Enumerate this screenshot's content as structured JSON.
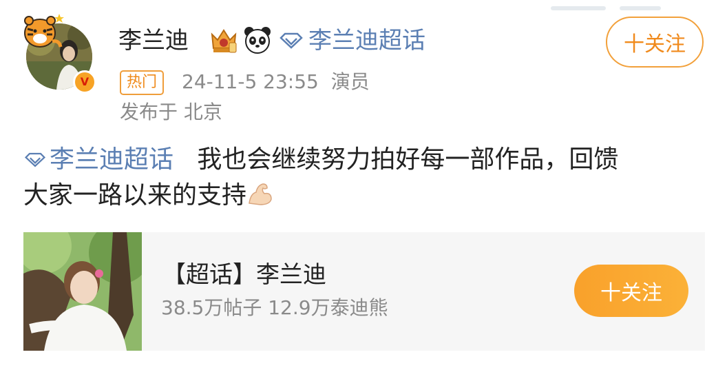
{
  "post": {
    "username": "李兰迪",
    "chaohua_link": "李兰迪超话",
    "follow_label": "十关注",
    "hot_tag": "热门",
    "timestamp": "24-11-5 23:55",
    "role": "演员",
    "location": "发布于 北京",
    "topic": "李兰迪超话",
    "text_line1": "我也会继续努力拍好每一部作品，回馈",
    "text_line2": "大家一路以来的支持"
  },
  "card": {
    "title": "【超话】李兰迪",
    "stats": "38.5万帖子 12.9万泰迪熊",
    "follow_label": "十关注"
  },
  "colors": {
    "link_blue": "#5b7fb3",
    "accent_orange": "#f7a325",
    "muted_gray": "#8a8a8a"
  },
  "icons": [
    "tiger-sticker-icon",
    "verified-v-icon",
    "crown-badge-icon",
    "panda-icon",
    "diamond-icon",
    "flexed-bicep-icon"
  ]
}
